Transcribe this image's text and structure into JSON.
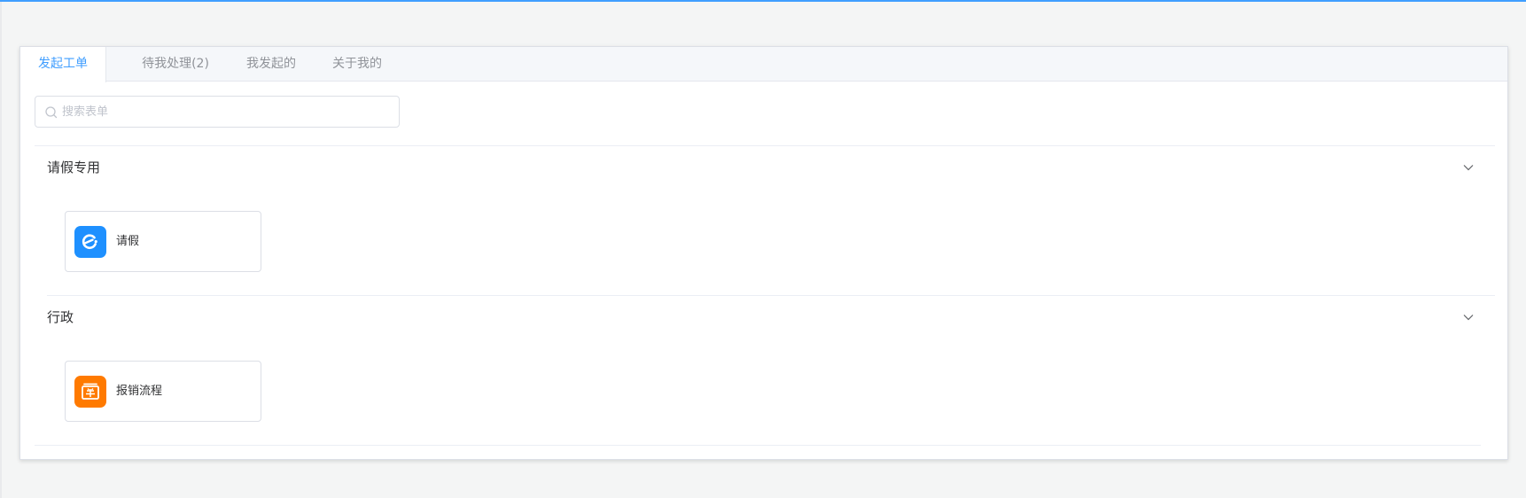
{
  "tabs": [
    {
      "label": "发起工单",
      "active": true
    },
    {
      "label": "待我处理(2)",
      "active": false
    },
    {
      "label": "我发起的",
      "active": false
    },
    {
      "label": "关于我的",
      "active": false
    }
  ],
  "search": {
    "placeholder": "搜索表单",
    "value": "",
    "icon": "search-icon"
  },
  "groups": [
    {
      "title": "请假专用",
      "collapse_icon": "chevron-down-icon",
      "items": [
        {
          "label": "请假",
          "icon": "leave-icon",
          "icon_color": "#1e90ff"
        }
      ]
    },
    {
      "title": "行政",
      "collapse_icon": "chevron-down-icon",
      "items": [
        {
          "label": "报销流程",
          "icon": "reimbursement-icon",
          "icon_color": "#ff7a00"
        }
      ]
    }
  ],
  "colors": {
    "accent": "#409eff",
    "page_bg": "#f4f5f5"
  }
}
